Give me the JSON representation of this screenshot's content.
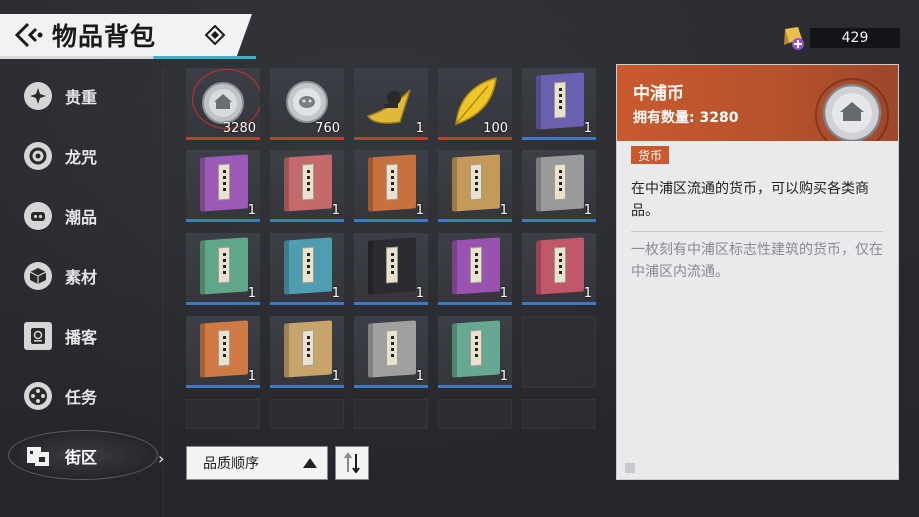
{
  "header": {
    "title": "物品背包"
  },
  "top_currency": {
    "amount": "429",
    "icon": "gem-icon"
  },
  "sidebar": {
    "items": [
      {
        "label": "贵重",
        "icon": "sparkle-icon",
        "active": false
      },
      {
        "label": "龙咒",
        "icon": "target-icon",
        "active": false
      },
      {
        "label": "潮品",
        "icon": "mask-icon",
        "active": false
      },
      {
        "label": "素材",
        "icon": "cube-icon",
        "active": false
      },
      {
        "label": "播客",
        "icon": "radio-icon",
        "active": false
      },
      {
        "label": "任务",
        "icon": "film-reel-icon",
        "active": false
      },
      {
        "label": "街区",
        "icon": "street-icon",
        "active": true
      }
    ]
  },
  "inventory": {
    "items": [
      {
        "type": "coin-zhongpu",
        "qty": "3280",
        "rarity": "red",
        "selected": true
      },
      {
        "type": "coin-silver",
        "qty": "760",
        "rarity": "red",
        "selected": false
      },
      {
        "type": "gold-horn",
        "qty": "1",
        "rarity": "red",
        "selected": false
      },
      {
        "type": "gold-leaf",
        "qty": "100",
        "rarity": "red",
        "selected": false
      },
      {
        "type": "book",
        "color": "#6a5fb0",
        "qty": "1",
        "rarity": "blue"
      },
      {
        "type": "book",
        "color": "#9a5ab5",
        "qty": "1",
        "rarity": "blue"
      },
      {
        "type": "book",
        "color": "#c46a6a",
        "qty": "1",
        "rarity": "blue"
      },
      {
        "type": "book",
        "color": "#c9703f",
        "qty": "1",
        "rarity": "blue"
      },
      {
        "type": "book",
        "color": "#c49a5a",
        "qty": "1",
        "rarity": "blue"
      },
      {
        "type": "book",
        "color": "#9a9a9a",
        "qty": "1",
        "rarity": "blue"
      },
      {
        "type": "book",
        "color": "#5fa68a",
        "qty": "1",
        "rarity": "blue"
      },
      {
        "type": "book",
        "color": "#4f9db0",
        "qty": "1",
        "rarity": "blue"
      },
      {
        "type": "book",
        "color": "#2a2c31",
        "qty": "1",
        "rarity": "blue"
      },
      {
        "type": "book",
        "color": "#9a52b0",
        "qty": "1",
        "rarity": "blue"
      },
      {
        "type": "book",
        "color": "#c2566a",
        "qty": "1",
        "rarity": "blue"
      },
      {
        "type": "book",
        "color": "#cf7a45",
        "qty": "1",
        "rarity": "blue"
      },
      {
        "type": "book",
        "color": "#c8a36a",
        "qty": "1",
        "rarity": "blue"
      },
      {
        "type": "book",
        "color": "#a0a0a0",
        "qty": "1",
        "rarity": "blue"
      },
      {
        "type": "book",
        "color": "#66a892",
        "qty": "1",
        "rarity": "blue"
      }
    ],
    "empty_cells": 6
  },
  "sort": {
    "label": "品质顺序"
  },
  "detail": {
    "name": "中浦币",
    "count_label": "拥有数量:",
    "count_value": "3280",
    "tag": "货币",
    "description": "在中浦区流通的货币，可以购买各类商品。",
    "lore": "一枚刻有中浦区标志性建筑的货币，仅在中浦区内流通。"
  },
  "colors": {
    "accent": "#c85a2e",
    "rarity_red": "#c63a34",
    "rarity_blue": "#3e78c8"
  }
}
